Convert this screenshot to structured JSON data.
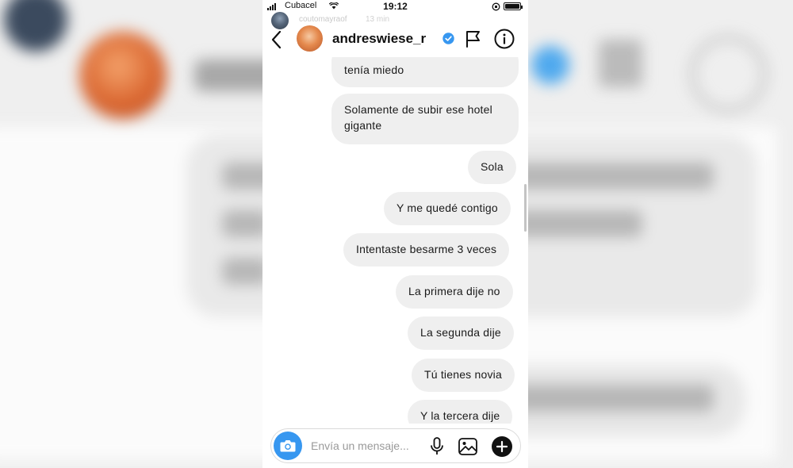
{
  "status_bar": {
    "carrier": "Cubacel",
    "time": "19:12"
  },
  "story_overlay": {
    "username": "coutomayraof",
    "time_ago": "13 min"
  },
  "chat_header": {
    "username": "andreswiese_r",
    "verified": true
  },
  "messages": [
    {
      "text": "tenía miedo",
      "side": "left"
    },
    {
      "text": "Solamente de subir ese hotel gigante",
      "side": "left"
    },
    {
      "text": "Sola",
      "side": "right"
    },
    {
      "text": "Y me quedé contigo",
      "side": "right"
    },
    {
      "text": "Intentaste besarme 3 veces",
      "side": "right"
    },
    {
      "text": "La primera dije no",
      "side": "right"
    },
    {
      "text": "La segunda dije",
      "side": "right"
    },
    {
      "text": "Tú tienes novia",
      "side": "right"
    },
    {
      "text": "Y la tercera dije",
      "side": "right"
    }
  ],
  "composer": {
    "placeholder": "Envía un mensaje..."
  },
  "icons": {
    "back": "chevron-left-icon",
    "verified": "verified-badge-icon",
    "flag": "flag-icon",
    "info": "info-icon",
    "camera": "camera-icon",
    "mic": "microphone-icon",
    "gallery": "gallery-icon",
    "plus": "plus-icon"
  },
  "colors": {
    "accent": "#3797f0",
    "bubble": "#efefef",
    "verified": "#3797f0"
  }
}
